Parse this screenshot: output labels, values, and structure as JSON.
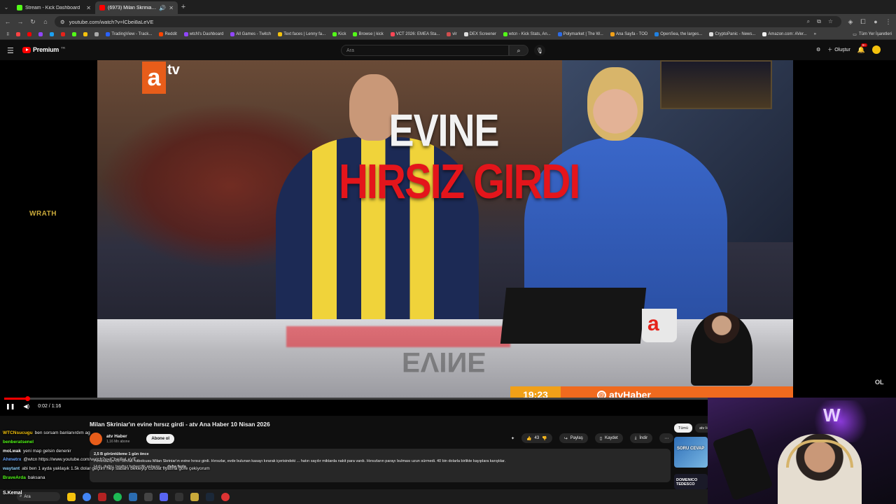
{
  "browser": {
    "tabs": [
      {
        "title": "Stream - Kick Dashboard",
        "fav_color": "#53fc18",
        "active": false
      },
      {
        "title": "(6973) Milan Skriniar'ın evi",
        "fav_color": "#ff0000",
        "active": true
      }
    ],
    "url": "youtube.com/watch?v=lCbei8aLeVE",
    "bookmarks": [
      {
        "label": "",
        "color": "#ff4444"
      },
      {
        "label": "",
        "color": "#ff0000"
      },
      {
        "label": "",
        "color": "#9146ff"
      },
      {
        "label": "",
        "color": "#1da1f2"
      },
      {
        "label": "",
        "color": "#e5231b"
      },
      {
        "label": "",
        "color": "#53fc18"
      },
      {
        "label": "",
        "color": "#f4c20d"
      },
      {
        "label": "",
        "color": "#aaaaaa"
      },
      {
        "label": "TradingView - Track...",
        "color": "#2962ff"
      },
      {
        "label": "Reddit",
        "color": "#ff4500"
      },
      {
        "label": "wtcN's Dashboard",
        "color": "#9146ff"
      },
      {
        "label": "All Games - Twitch",
        "color": "#9146ff"
      },
      {
        "label": "Text faces | Lenny fa...",
        "color": "#f4c20d"
      },
      {
        "label": "Kick",
        "color": "#53fc18"
      },
      {
        "label": "Browse | kick",
        "color": "#53fc18"
      },
      {
        "label": "VCT 2026: EMEA Sta...",
        "color": "#ff4655"
      },
      {
        "label": "vlr",
        "color": "#d04e4e"
      },
      {
        "label": "DEX Screener",
        "color": "#dddddd"
      },
      {
        "label": "wtcn - Kick Stats, An...",
        "color": "#53fc18"
      },
      {
        "label": "Polymarket | The W...",
        "color": "#2c6be6"
      },
      {
        "label": "Ana Sayfa - TOD",
        "color": "#f1a018"
      },
      {
        "label": "OpenSea, the larges...",
        "color": "#2081e2"
      },
      {
        "label": "CryptoPanic - News...",
        "color": "#dddddd"
      },
      {
        "label": "Amazon.com: AVer...",
        "color": "#f1f1f1"
      }
    ],
    "all_bookmarks": "Tüm Yer İşaretleri"
  },
  "youtube": {
    "logo_word": "Premium",
    "logo_sup": "TR",
    "search_placeholder": "Ara",
    "create_label": "Oluştur",
    "notif_count": "9+"
  },
  "video": {
    "overlay_word1": "EVINE",
    "overlay_word2": "HIRSIZ GIRDI",
    "logo_letter": "a",
    "logo_tv": "tv",
    "clock": "19:23",
    "handle": "atvHaber",
    "watermark": "WRATH",
    "corner_logo": "OL",
    "time": "0:02 / 1:16",
    "progress": 0.026
  },
  "meta": {
    "title": "Milan Skriniar'ın evine hırsız girdi - atv Ana Haber 10 Nisan 2026",
    "channel": "atv Haber",
    "subs": "1,16 Mn abone",
    "subscribe": "Abone ol",
    "likes": "43",
    "share": "Paylaş",
    "save": "Kaydet",
    "download": "İndir",
    "stats": "2,5 B görüntüleme  1 gün önce",
    "desc_line1": "Fenerbahçe'nin Slovak futbolcusu Milan Skriniar'ın evine hırsız girdi. Hırsızlar, evde bulunan kasayı kırarak içerisindeki ... hatırı sayılır miktarda nakit para vardı. Hırsızların parayı bulması uzun sürmedi. 40 bin dolarla birlikte kayıplara karıştılar.",
    "desc_line2": "Hızlı, doğru, tarafsız habercilik anlayışı...",
    "desc_more": "...daha fazla"
  },
  "chat": [
    {
      "user": "WTCNsucugu",
      "color": "#f4c20d",
      "msg": "ben sorsam banlanırdım ag"
    },
    {
      "user": "benberatsenel",
      "color": "#53fc18",
      "msg": ""
    },
    {
      "user": "moLwak",
      "color": "#ffffff",
      "msg": "yeni map gelsin denenir"
    },
    {
      "user": "Ahmetrx",
      "color": "#6aa6ff",
      "msg": "@wtcn https://www.youtube.com/watch?v=lCbei8aLeVE"
    },
    {
      "user": "waytant",
      "color": "#8fd3ff",
      "msg": "abi ben 1 ayda yaklaşık 1.5k dolar geçtim hep sabahı bekleyip cs/loat fiyatına göre çekiyorum"
    },
    {
      "user": "BraveArda",
      "color": "#53fc18",
      "msg": "baksana"
    }
  ],
  "sidebar": {
    "chip_all": "Tümü",
    "chip_atv": "atv H",
    "thumb1_text": "SORU CEVAP",
    "thumb2_text": "DOMENICO TEDESCO"
  },
  "taskbar": {
    "search": "Ara",
    "streamer_name": "S.Kemal"
  },
  "colors": {
    "yt_red": "#ff0000",
    "atv_orange": "#e85d1a",
    "headline_red": "#e4151b",
    "kick_green": "#53fc18"
  }
}
